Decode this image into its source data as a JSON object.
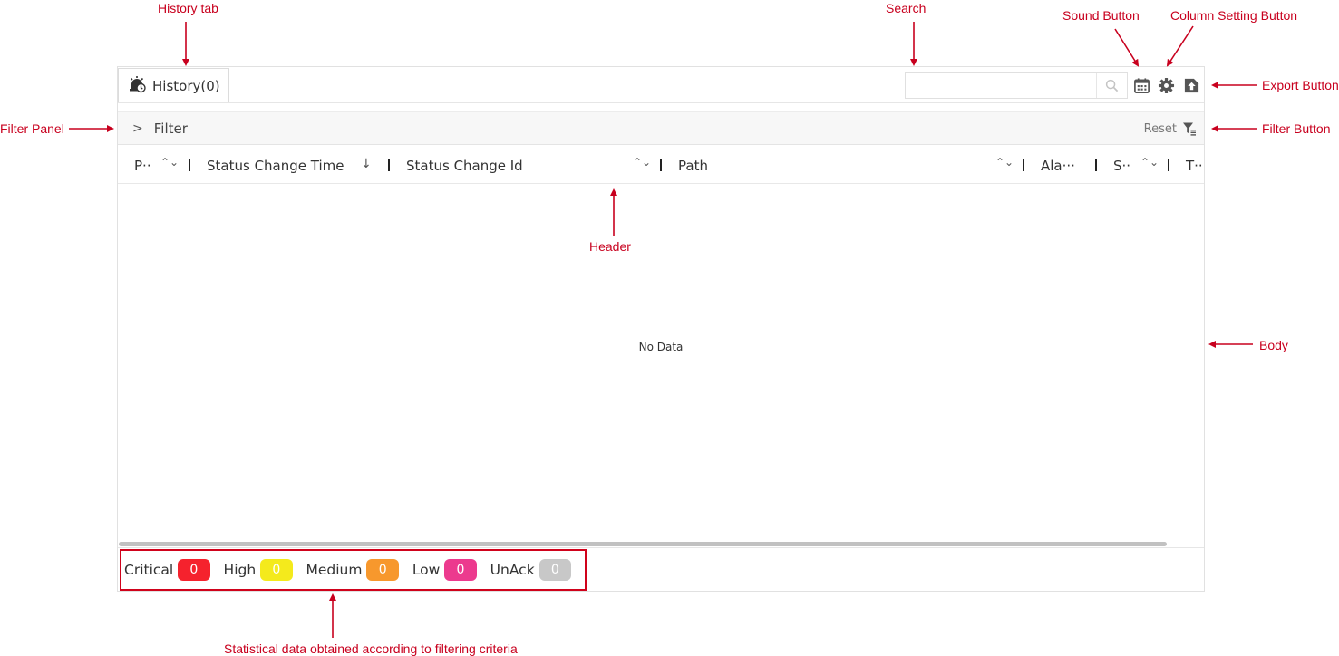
{
  "colors": {
    "annotation": "#c8001e",
    "critical": "#f5222d",
    "high": "#f4ea1c",
    "medium": "#f7982d",
    "low": "#ec3a8e",
    "unack": "#c8c8c8"
  },
  "toolbar": {
    "history_tab": {
      "label": "History(0)",
      "icon": "alarm-clock-icon"
    },
    "search": {
      "placeholder": "",
      "icon": "search-icon"
    },
    "sound_button": {
      "icon": "calendar-icon"
    },
    "column_setting_button": {
      "icon": "gear-icon"
    },
    "export_button": {
      "icon": "export-upload-icon"
    }
  },
  "filter": {
    "toggle_symbol": ">",
    "label": "Filter",
    "reset_label": "Reset",
    "button_icon": "filter-funnel-icon"
  },
  "table": {
    "columns": [
      {
        "label": "P··",
        "sort": "both"
      },
      {
        "label": "Status Change Time",
        "sort": "desc"
      },
      {
        "label": "Status Change Id",
        "sort": "both"
      },
      {
        "label": "Path",
        "sort": "both"
      },
      {
        "label": "Ala···",
        "sort": "none"
      },
      {
        "label": "S··",
        "sort": "both"
      },
      {
        "label": "T··",
        "sort": "none"
      }
    ],
    "sort_both_glyph": "⌃⌄",
    "sort_desc_glyph": "↓",
    "empty_text": "No Data"
  },
  "stats": [
    {
      "label": "Critical",
      "count": "0"
    },
    {
      "label": "High",
      "count": "0"
    },
    {
      "label": "Medium",
      "count": "0"
    },
    {
      "label": "Low",
      "count": "0"
    },
    {
      "label": "UnAck",
      "count": "0"
    }
  ],
  "annotations": {
    "history_tab": "History tab",
    "search": "Search",
    "sound_button": "Sound Button",
    "column_setting_button": "Column Setting Button",
    "export_button": "Export Button",
    "filter_panel": "Filter Panel",
    "filter_button": "Filter Button",
    "header": "Header",
    "body": "Body",
    "stats": "Statistical data obtained according to filtering criteria"
  }
}
